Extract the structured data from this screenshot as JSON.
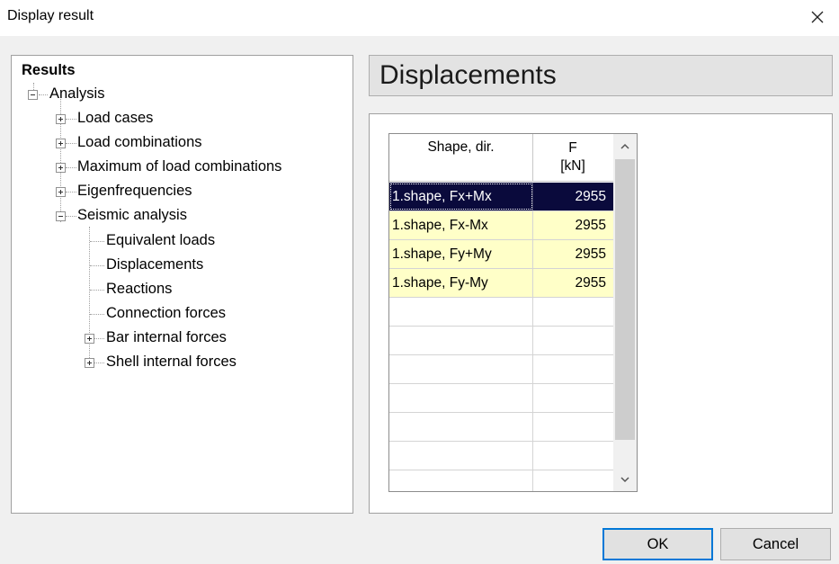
{
  "window": {
    "title": "Display result"
  },
  "tree": {
    "root": "Results",
    "items": [
      {
        "label": "Analysis"
      },
      {
        "label": "Load cases"
      },
      {
        "label": "Load combinations"
      },
      {
        "label": "Maximum of load combinations"
      },
      {
        "label": "Eigenfrequencies"
      },
      {
        "label": "Seismic analysis"
      },
      {
        "label": "Equivalent loads"
      },
      {
        "label": "Displacements"
      },
      {
        "label": "Reactions"
      },
      {
        "label": "Connection forces"
      },
      {
        "label": "Bar internal forces"
      },
      {
        "label": "Shell internal forces"
      }
    ]
  },
  "panel": {
    "title": "Displacements"
  },
  "grid": {
    "columns": [
      {
        "header": "Shape, dir."
      },
      {
        "header": "F",
        "unit": "[kN]"
      }
    ],
    "rows": [
      {
        "shape": "1.shape, Fx+Mx",
        "value": "2955"
      },
      {
        "shape": "1.shape, Fx-Mx",
        "value": "2955"
      },
      {
        "shape": "1.shape, Fy+My",
        "value": "2955"
      },
      {
        "shape": "1.shape, Fy-My",
        "value": "2955"
      }
    ]
  },
  "buttons": {
    "ok": "OK",
    "cancel": "Cancel"
  },
  "icons": {
    "close": "close-icon",
    "scroll_up": "chevron-up-icon",
    "scroll_down": "chevron-down-icon"
  },
  "colors": {
    "selected_row": "#0a0a3c",
    "data_row": "#ffffc8",
    "default_button_border": "#0078d7"
  }
}
